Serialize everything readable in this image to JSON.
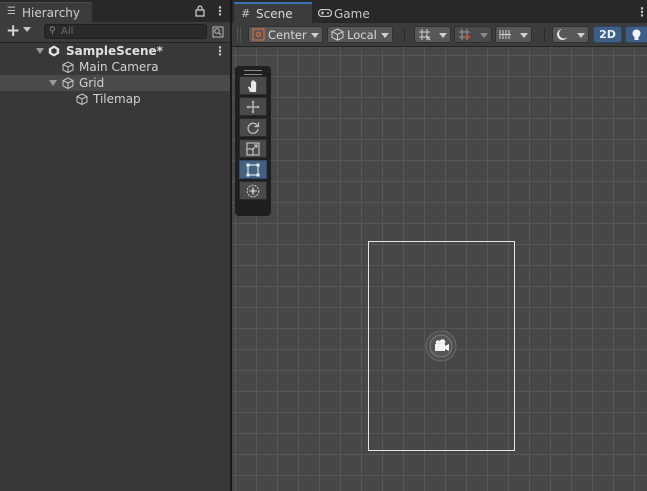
{
  "hierarchy": {
    "tab_label": "Hierarchy",
    "tab_icon": "list-icon",
    "search_placeholder": "All",
    "items": [
      {
        "label": "SampleScene*",
        "icon": "unity-scene-icon",
        "expanded": true
      },
      {
        "label": "Main Camera",
        "icon": "cube-icon"
      },
      {
        "label": "Grid",
        "icon": "cube-icon",
        "expanded": true,
        "selected": true
      },
      {
        "label": "Tilemap",
        "icon": "cube-icon"
      }
    ]
  },
  "scene": {
    "tabs": [
      {
        "label": "Scene",
        "icon": "grid-hash-icon",
        "active": true
      },
      {
        "label": "Game",
        "icon": "gamepad-icon",
        "active": false
      }
    ],
    "toolbar": {
      "pivot_label": "Center",
      "space_label": "Local",
      "mode_2d_label": "2D"
    },
    "tools": [
      "hand-tool",
      "move-tool",
      "rotate-tool",
      "scale-tool",
      "rect-tool",
      "transform-tool"
    ],
    "selected_tool": "rect-tool"
  },
  "colors": {
    "accent": "#3a72b0",
    "selected_tool": "#46607f",
    "grid_line": "#575757",
    "viewport_bg": "#474747"
  }
}
